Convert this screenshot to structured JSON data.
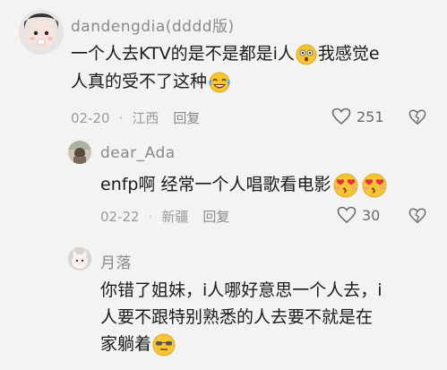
{
  "comments": [
    {
      "username": "dandengdia(dddd版)",
      "line1": "一个人去KTV的是不是都是i人",
      "line1b": "我感觉e",
      "line2": "人真的受不了这种",
      "date": "02-20",
      "location": "江西",
      "reply": "回复",
      "likes": "251",
      "avatar_icon": "girl-face-avatar",
      "emojis": [
        "surprised-face-icon",
        "crying-laughing-face-icon"
      ]
    },
    {
      "username": "dear_Ada",
      "line1": "enfp啊  经常一个人唱歌看电影",
      "date": "02-22",
      "location": "新疆",
      "reply": "回复",
      "likes": "30",
      "avatar_icon": "photo-avatar",
      "emojis": [
        "heart-eyes-face-icon",
        "heart-eyes-face-icon"
      ]
    },
    {
      "username": "月落",
      "line1": "你错了姐妹，i人哪好意思一个人去，i",
      "line2": "人要不跟特别熟悉的人去要不就是在",
      "line3": "家躺着",
      "avatar_icon": "cat-avatar",
      "emojis": [
        "sunglasses-smirk-face-icon"
      ]
    }
  ],
  "colors": {
    "background": "#f3f3f3",
    "username": "#8a8a8a",
    "text": "#1a1a1a",
    "meta": "#9a9a9a",
    "emoji_yellow": "#f7c531"
  }
}
